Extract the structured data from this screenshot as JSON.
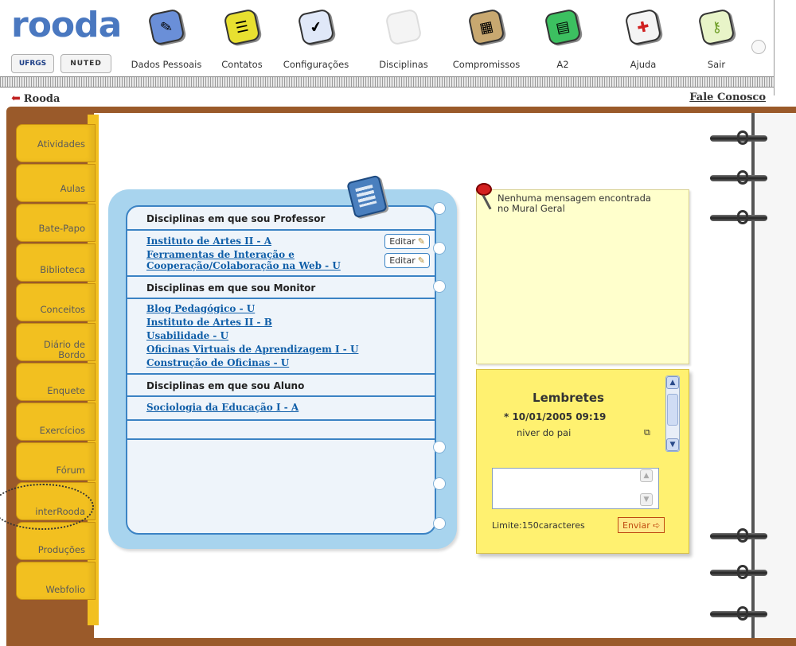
{
  "brand": {
    "logo": "rooda",
    "sublogos": [
      "UFRGS",
      "NUTED"
    ]
  },
  "nav": [
    {
      "label": "Dados Pessoais",
      "icon": "user-id-card-icon"
    },
    {
      "label": "Contatos",
      "icon": "address-book-icon"
    },
    {
      "label": "Configurações",
      "icon": "settings-clipboard-icon"
    },
    {
      "label": "Disciplinas",
      "icon": "folder-icon"
    },
    {
      "label": "Compromissos",
      "icon": "calendar-icon"
    },
    {
      "label": "A2",
      "icon": "a2-device-icon"
    },
    {
      "label": "Ajuda",
      "icon": "first-aid-icon"
    },
    {
      "label": "Sair",
      "icon": "door-key-icon"
    }
  ],
  "breadcrumb": {
    "back_label": "Rooda",
    "contact_link": "Fale Conosco"
  },
  "side_tabs": [
    {
      "label": "Atividades"
    },
    {
      "label": "Aulas"
    },
    {
      "label": "Bate-Papo"
    },
    {
      "label": "Biblioteca"
    },
    {
      "label": "Conceitos"
    },
    {
      "label": "Diário de Bordo",
      "lines": [
        "Diário de",
        "Bordo"
      ]
    },
    {
      "label": "Enquete"
    },
    {
      "label": "Exercícios"
    },
    {
      "label": "Fórum"
    },
    {
      "label": "interRooda"
    },
    {
      "label": "Produções"
    },
    {
      "label": "Webfolio"
    }
  ],
  "disciplines": {
    "professor_heading": "Disciplinas em que sou Professor",
    "professor": [
      {
        "name": "Instituto de Artes II - A",
        "lines": [
          "Instituto de Artes II - A"
        ],
        "edit_label": "Editar"
      },
      {
        "name": "Ferramentas de Interação e Cooperação/Colaboração na Web - U",
        "lines": [
          "Ferramentas de Interação e",
          "Cooperação/Colaboração na Web - U"
        ],
        "edit_label": "Editar"
      }
    ],
    "monitor_heading": "Disciplinas em que sou Monitor",
    "monitor": [
      "Blog Pedagógico - U",
      "Instituto de Artes II - B",
      "Usabilidade - U",
      "Oficinas Virtuais de Aprendizagem I - U",
      "Construção de Oficinas - U"
    ],
    "student_heading": "Disciplinas em que sou Aluno",
    "student": [
      "Sociologia da Educação I - A"
    ]
  },
  "mural": {
    "message": "Nenhuma mensagem encontrada no Mural Geral"
  },
  "reminders": {
    "title": "Lembretes",
    "items": [
      {
        "date": "* 10/01/2005 09:19",
        "text": "niver do pai"
      }
    ],
    "input_value": "",
    "limit_text": "Limite:150caracteres",
    "send_label": "Enviar"
  },
  "colors": {
    "accent_blue": "#3b83c4",
    "tab_yellow": "#f2c020",
    "binder_brown": "#9a5a2a",
    "link_blue": "#0f5ea8"
  }
}
